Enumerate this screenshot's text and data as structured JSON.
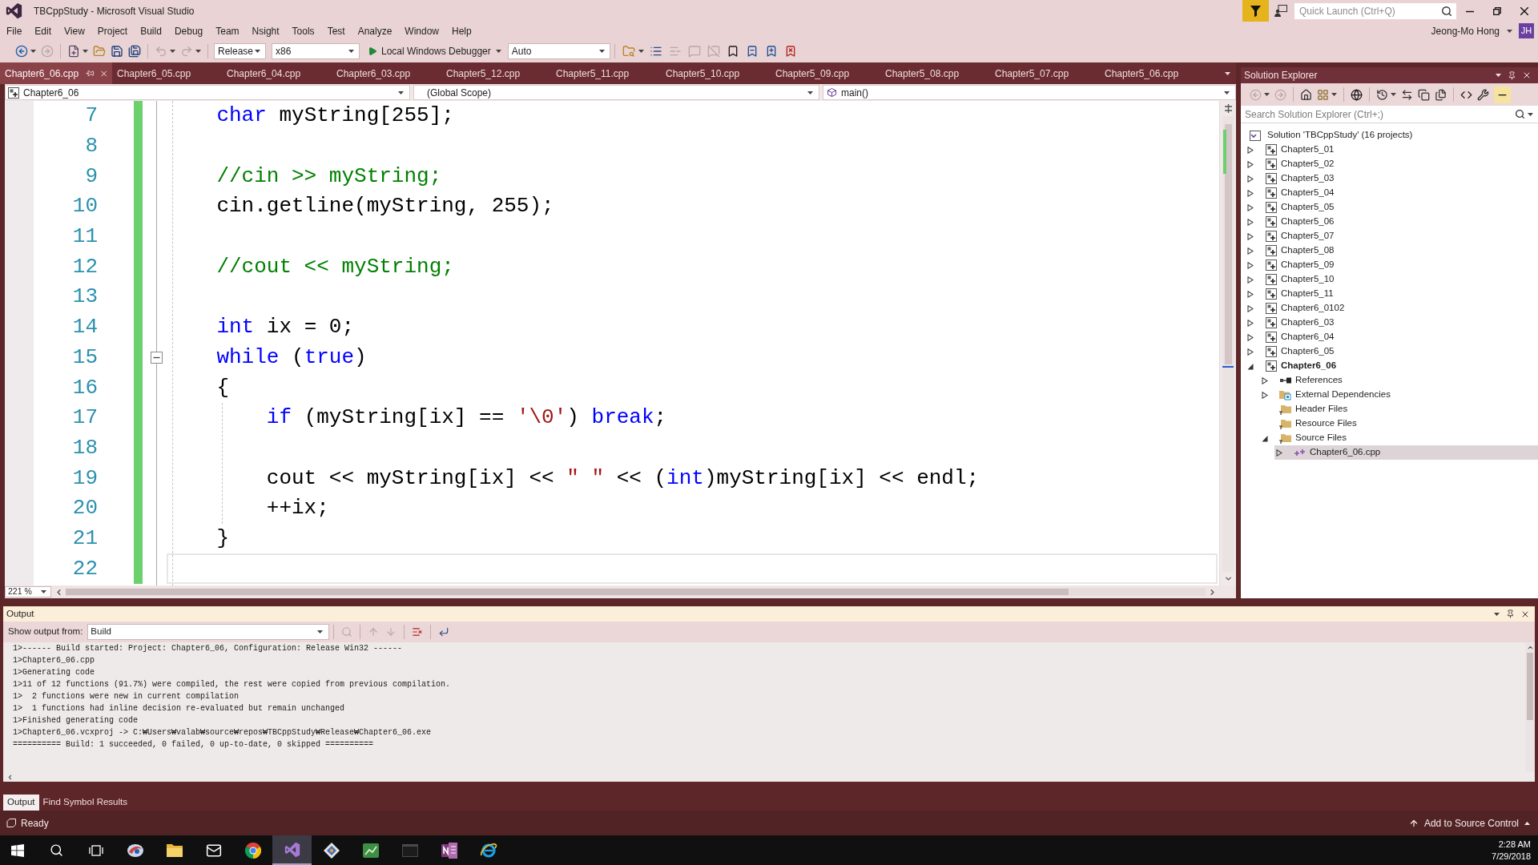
{
  "window": {
    "title": "TBCppStudy - Microsoft Visual Studio",
    "quick_launch": {
      "placeholder": "Quick Launch (Ctrl+Q)"
    },
    "user": {
      "name": "Jeong-Mo Hong",
      "initials": "JH"
    }
  },
  "menu": [
    "File",
    "Edit",
    "View",
    "Project",
    "Build",
    "Debug",
    "Team",
    "Nsight",
    "Tools",
    "Test",
    "Analyze",
    "Window",
    "Help"
  ],
  "toolbar": {
    "buttons": [
      {
        "kind": "back",
        "disabled": false
      },
      {
        "kind": "forward",
        "disabled": true
      },
      {
        "kind": "new_project",
        "disabled": false
      },
      {
        "kind": "open",
        "disabled": false
      },
      {
        "kind": "save",
        "disabled": false
      },
      {
        "kind": "save_all",
        "disabled": false
      },
      {
        "kind": "undo",
        "disabled": true
      },
      {
        "kind": "redo",
        "disabled": true
      }
    ],
    "configuration": "Release",
    "platform": "x86",
    "debugger": "Local Windows Debugger",
    "debugger_target": "Auto",
    "more_buttons": [
      {
        "kind": "find",
        "disabled": false
      },
      {
        "kind": "indent",
        "disabled": false
      },
      {
        "kind": "outdent",
        "disabled": true
      },
      {
        "kind": "comment",
        "disabled": true
      },
      {
        "kind": "uncomment",
        "disabled": true
      },
      {
        "kind": "bookmark",
        "disabled": false
      },
      {
        "kind": "bookmark_prev",
        "disabled": false
      },
      {
        "kind": "bookmark_next",
        "disabled": false
      },
      {
        "kind": "bookmark_clear",
        "disabled": false
      }
    ]
  },
  "tabs": [
    {
      "label": "Chapter6_06.cpp",
      "selected": true
    },
    {
      "label": "Chapter6_05.cpp",
      "selected": false
    },
    {
      "label": "Chapter6_04.cpp",
      "selected": false
    },
    {
      "label": "Chapter6_03.cpp",
      "selected": false
    },
    {
      "label": "Chapter5_12.cpp",
      "selected": false
    },
    {
      "label": "Chapter5_11.cpp",
      "selected": false
    },
    {
      "label": "Chapter5_10.cpp",
      "selected": false
    },
    {
      "label": "Chapter5_09.cpp",
      "selected": false
    },
    {
      "label": "Chapter5_08.cpp",
      "selected": false
    },
    {
      "label": "Chapter5_07.cpp",
      "selected": false
    },
    {
      "label": "Chapter5_06.cpp",
      "selected": false
    }
  ],
  "navigation_bar": {
    "project": "Chapter6_06",
    "scope": "(Global Scope)",
    "member": "main()"
  },
  "editor": {
    "saved_changes": true,
    "zoom": "221 %",
    "lines": [
      {
        "number": "7",
        "current": false,
        "tokens": [
          {
            "kind": "keyword",
            "text": "    char"
          },
          {
            "kind": "plain",
            "text": " myString[255];"
          }
        ]
      },
      {
        "number": "8",
        "current": false
      },
      {
        "number": "9",
        "current": false,
        "tokens": [
          {
            "kind": "comment",
            "text": "    //cin >> myString;"
          }
        ]
      },
      {
        "number": "10",
        "current": false,
        "tokens": [
          {
            "kind": "plain",
            "text": "    cin.getline(myString, 255);"
          }
        ]
      },
      {
        "number": "11",
        "current": false
      },
      {
        "number": "12",
        "current": false,
        "tokens": [
          {
            "kind": "comment",
            "text": "    //cout << myString;"
          }
        ]
      },
      {
        "number": "13",
        "current": false
      },
      {
        "number": "14",
        "current": false,
        "tokens": [
          {
            "kind": "keyword",
            "text": "    int"
          },
          {
            "kind": "plain",
            "text": " ix = 0;"
          }
        ]
      },
      {
        "number": "15",
        "current": false,
        "fold_expanded": true,
        "tokens": [
          {
            "kind": "keyword",
            "text": "    while"
          },
          {
            "kind": "plain",
            "text": " ("
          },
          {
            "kind": "keyword",
            "text": "true"
          },
          {
            "kind": "plain",
            "text": ")"
          }
        ]
      },
      {
        "number": "16",
        "current": false,
        "tokens": [
          {
            "kind": "plain",
            "text": "    {"
          }
        ]
      },
      {
        "number": "17",
        "current": false,
        "tokens": [
          {
            "kind": "keyword",
            "text": "        if"
          },
          {
            "kind": "plain",
            "text": " (myString[ix] == "
          },
          {
            "kind": "string",
            "text": "'\\0'"
          },
          {
            "kind": "plain",
            "text": ") "
          },
          {
            "kind": "keyword",
            "text": "break"
          },
          {
            "kind": "plain",
            "text": ";"
          }
        ]
      },
      {
        "number": "18",
        "current": false
      },
      {
        "number": "19",
        "current": false,
        "tokens": [
          {
            "kind": "plain",
            "text": "        cout << myString[ix] << "
          },
          {
            "kind": "string",
            "text": "\" \""
          },
          {
            "kind": "plain",
            "text": " << ("
          },
          {
            "kind": "keyword",
            "text": "int"
          },
          {
            "kind": "plain",
            "text": ")myString[ix] << endl;"
          }
        ]
      },
      {
        "number": "20",
        "current": false,
        "tokens": [
          {
            "kind": "plain",
            "text": "        ++ix;"
          }
        ]
      },
      {
        "number": "21",
        "current": false,
        "tokens": [
          {
            "kind": "plain",
            "text": "    }"
          }
        ]
      },
      {
        "number": "22",
        "current": true
      }
    ]
  },
  "solution_explorer": {
    "title": "Solution Explorer",
    "toolbar": [
      {
        "kind": "back",
        "disabled": true,
        "on": false
      },
      {
        "kind": "forward",
        "disabled": true,
        "on": false
      },
      {
        "kind": "home",
        "disabled": false,
        "on": false
      },
      {
        "kind": "switch_views",
        "disabled": false,
        "on": false
      },
      {
        "kind": "globe",
        "disabled": false,
        "on": false
      },
      {
        "kind": "history",
        "disabled": false,
        "on": false
      },
      {
        "kind": "sync",
        "disabled": false,
        "on": false
      },
      {
        "kind": "collapse",
        "disabled": false,
        "on": false
      },
      {
        "kind": "show_all",
        "disabled": false,
        "on": false
      },
      {
        "kind": "code",
        "disabled": false,
        "on": false
      },
      {
        "kind": "properties",
        "disabled": false,
        "on": false
      },
      {
        "kind": "preview",
        "disabled": false,
        "on": true
      }
    ],
    "search": {
      "placeholder": "Search Solution Explorer (Ctrl+;)"
    },
    "solution": {
      "label": "Solution 'TBCppStudy' (16 projects)",
      "children": [
        {
          "label": "Chapter5_01",
          "kind": "project",
          "expanded": false,
          "startup": false,
          "selected": false
        },
        {
          "label": "Chapter5_02",
          "kind": "project",
          "expanded": false,
          "startup": false,
          "selected": false
        },
        {
          "label": "Chapter5_03",
          "kind": "project",
          "expanded": false,
          "startup": false,
          "selected": false
        },
        {
          "label": "Chapter5_04",
          "kind": "project",
          "expanded": false,
          "startup": false,
          "selected": false
        },
        {
          "label": "Chapter5_05",
          "kind": "project",
          "expanded": false,
          "startup": false,
          "selected": false
        },
        {
          "label": "Chapter5_06",
          "kind": "project",
          "expanded": false,
          "startup": false,
          "selected": false
        },
        {
          "label": "Chapter5_07",
          "kind": "project",
          "expanded": false,
          "startup": false,
          "selected": false
        },
        {
          "label": "Chapter5_08",
          "kind": "project",
          "expanded": false,
          "startup": false,
          "selected": false
        },
        {
          "label": "Chapter5_09",
          "kind": "project",
          "expanded": false,
          "startup": false,
          "selected": false
        },
        {
          "label": "Chapter5_10",
          "kind": "project",
          "expanded": false,
          "startup": false,
          "selected": false
        },
        {
          "label": "Chapter5_11",
          "kind": "project",
          "expanded": false,
          "startup": false,
          "selected": false
        },
        {
          "label": "Chapter6_0102",
          "kind": "project",
          "expanded": false,
          "startup": false,
          "selected": false
        },
        {
          "label": "Chapter6_03",
          "kind": "project",
          "expanded": false,
          "startup": false,
          "selected": false
        },
        {
          "label": "Chapter6_04",
          "kind": "project",
          "expanded": false,
          "startup": false,
          "selected": false
        },
        {
          "label": "Chapter6_05",
          "kind": "project",
          "expanded": false,
          "startup": false,
          "selected": false
        },
        {
          "label": "Chapter6_06",
          "kind": "project",
          "expanded": true,
          "startup": true,
          "selected": false,
          "children": [
            {
              "label": "References",
              "kind": "references",
              "expanded": false,
              "selected": false
            },
            {
              "label": "External Dependencies",
              "kind": "dependencies",
              "expanded": false,
              "selected": false
            },
            {
              "label": "Header Files",
              "kind": "filter",
              "selected": false
            },
            {
              "label": "Resource Files",
              "kind": "filter",
              "selected": false
            },
            {
              "label": "Source Files",
              "kind": "filter",
              "expanded": true,
              "selected": false,
              "children": [
                {
                  "label": "Chapter6_06.cpp",
                  "kind": "cpp",
                  "expanded": false,
                  "selected": true
                }
              ]
            }
          ]
        }
      ]
    }
  },
  "output": {
    "title": "Output",
    "source_label": "Show output from:",
    "source": "Build",
    "toolbar": [
      {
        "kind": "find_in_code",
        "disabled": true
      },
      {
        "kind": "previous",
        "disabled": true
      },
      {
        "kind": "next",
        "disabled": true
      },
      {
        "kind": "clear",
        "disabled": false
      },
      {
        "kind": "wrap",
        "disabled": false
      }
    ],
    "lines": [
      "1>------ Build started: Project: Chapter6_06, Configuration: Release Win32 ------",
      "1>Chapter6_06.cpp",
      "1>Generating code",
      "1>11 of 12 functions (91.7%) were compiled, the rest were copied from previous compilation.",
      "1>  2 functions were new in current compilation",
      "1>  1 functions had inline decision re-evaluated but remain unchanged",
      "1>Finished generating code",
      "1>Chapter6_06.vcxproj -> C:₩Users₩valab₩source₩repos₩TBCppStudy₩Release₩Chapter6_06.exe",
      "========== Build: 1 succeeded, 0 failed, 0 up-to-date, 0 skipped =========="
    ],
    "tabs": [
      {
        "label": "Output",
        "selected": true
      },
      {
        "label": "Find Symbol Results",
        "selected": false
      }
    ]
  },
  "status_bar": {
    "message": "Ready",
    "source_control": "Add to Source Control"
  },
  "taskbar": {
    "items": [
      {
        "kind": "start",
        "active": false
      },
      {
        "kind": "search",
        "active": false
      },
      {
        "kind": "task_view",
        "active": false
      },
      {
        "kind": "swirl_app",
        "active": false
      },
      {
        "kind": "files",
        "active": false
      },
      {
        "kind": "mail",
        "active": false
      },
      {
        "kind": "ring_browser",
        "active": false
      },
      {
        "kind": "ide",
        "active": true
      },
      {
        "kind": "diamond_app",
        "active": false
      },
      {
        "kind": "chart_app",
        "active": false
      },
      {
        "kind": "console",
        "active": false
      },
      {
        "kind": "notebook",
        "active": false
      },
      {
        "kind": "orbit_browser",
        "active": false
      }
    ],
    "time": "2:28 AM",
    "date": "7/29/2018"
  }
}
